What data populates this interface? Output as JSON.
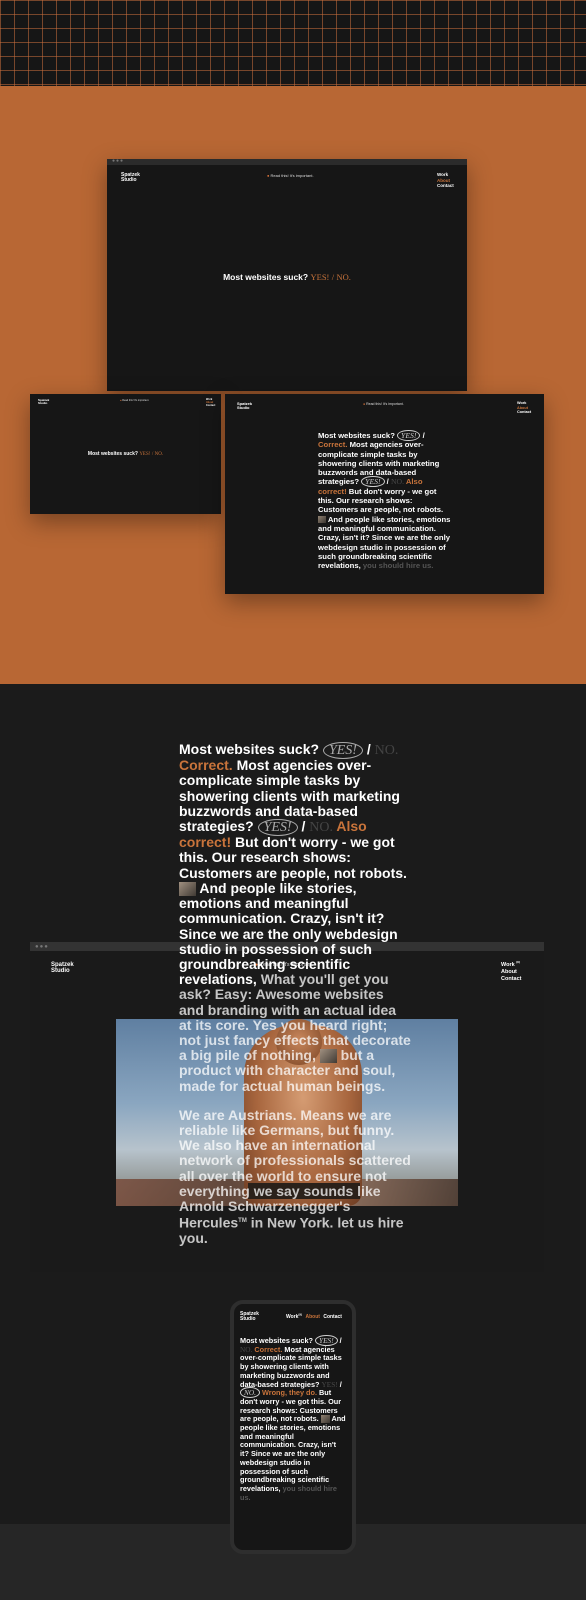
{
  "site": {
    "logo_line1": "Spatzek",
    "logo_line2": "Studio",
    "notice": "Read this! It's important.",
    "nav": {
      "work": "Work",
      "work_sup": "(9)",
      "about": "About",
      "contact": "Contact"
    }
  },
  "hero": {
    "text": "Most websites suck?",
    "yes": "YES!",
    "slash": "/",
    "no": "NO."
  },
  "intro": {
    "q": "Most websites suck?",
    "yes": "YES!",
    "slash": "/",
    "no": "NO.",
    "correct": "Correct.",
    "s1": "Most agencies over-complicate simple tasks by showering clients with marketing buzzwords and data-based strategies?",
    "also_correct": "Also correct!",
    "s2": "But don't worry - we got this. Our research shows: Customers are people, not robots.",
    "s3": "And people like stories, emotions and meaningful communication. Crazy, isn't it? Since we are the only webdesign studio in possession of such groundbreaking scientific revelations,",
    "s3_tail": "you should hire us.",
    "s4": "What you'll get you ask? Easy: Awesome websites and branding with an actual idea at its core. Yes you heard right; not just fancy effects that decorate a big pile of nothing,",
    "s5": "but a product with character and soul, made for actual human beings.",
    "p2": "We are Austrians. Means we are reliable like Germans, but funny. We also have an international network of professionals scattered all over the world to ensure not everything we say sounds like Arnold Schwarzenegger's Hercules",
    "p2_tail": "in New York.",
    "p2_end": "let us hire you."
  },
  "mobile": {
    "wrong": "Wrong, they do.",
    "s2": "But don't worry - we got this. Our research shows: Customers are people, not robots.",
    "s3": "And people like stories, emotions and meaningful communication. Crazy, isn't it? Since we are the only webdesign studio in possession of such groundbreaking scientific revelations,",
    "s3_tail": "you should hire us."
  },
  "colors": {
    "accent": "#c9743b",
    "band_orange": "#b86734",
    "dark": "#161616"
  }
}
